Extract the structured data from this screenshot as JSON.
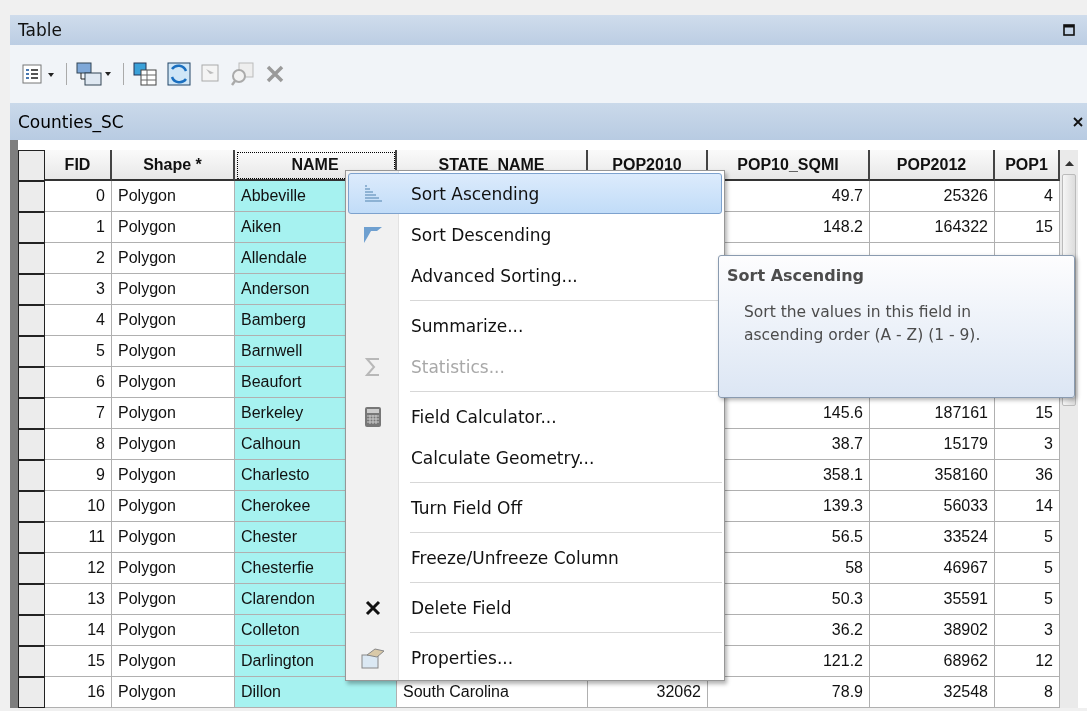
{
  "window": {
    "title": "Table"
  },
  "table_tab": {
    "title": "Counties_SC"
  },
  "columns": [
    {
      "label": "FID",
      "selected": false
    },
    {
      "label": "Shape *",
      "selected": false
    },
    {
      "label": "NAME",
      "selected": true
    },
    {
      "label": "STATE_NAME",
      "selected": false
    },
    {
      "label": "POP2010",
      "selected": false
    },
    {
      "label": "POP10_SQMI",
      "selected": false
    },
    {
      "label": "POP2012",
      "selected": false
    },
    {
      "label": "POP1",
      "selected": false
    }
  ],
  "rows": [
    {
      "fid": "0",
      "shape": "Polygon",
      "name": "Abbeville",
      "pop10_sqmi": "49.7",
      "pop2012": "25326",
      "pop1": "4"
    },
    {
      "fid": "1",
      "shape": "Polygon",
      "name": "Aiken",
      "pop10_sqmi": "148.2",
      "pop2012": "164322",
      "pop1": "15"
    },
    {
      "fid": "2",
      "shape": "Polygon",
      "name": "Allendale"
    },
    {
      "fid": "3",
      "shape": "Polygon",
      "name": "Anderson"
    },
    {
      "fid": "4",
      "shape": "Polygon",
      "name": "Bamberg"
    },
    {
      "fid": "5",
      "shape": "Polygon",
      "name": "Barnwell"
    },
    {
      "fid": "6",
      "shape": "Polygon",
      "name": "Beaufort"
    },
    {
      "fid": "7",
      "shape": "Polygon",
      "name": "Berkeley",
      "pop10_sqmi": "145.6",
      "pop2012": "187161",
      "pop1": "15"
    },
    {
      "fid": "8",
      "shape": "Polygon",
      "name": "Calhoun",
      "pop10_sqmi": "38.7",
      "pop2012": "15179",
      "pop1": "3"
    },
    {
      "fid": "9",
      "shape": "Polygon",
      "name": "Charlesto",
      "pop10_sqmi": "358.1",
      "pop2012": "358160",
      "pop1": "36"
    },
    {
      "fid": "10",
      "shape": "Polygon",
      "name": "Cherokee",
      "pop10_sqmi": "139.3",
      "pop2012": "56033",
      "pop1": "14"
    },
    {
      "fid": "11",
      "shape": "Polygon",
      "name": "Chester",
      "pop10_sqmi": "56.5",
      "pop2012": "33524",
      "pop1": "5"
    },
    {
      "fid": "12",
      "shape": "Polygon",
      "name": "Chesterfie",
      "pop10_sqmi": "58",
      "pop2012": "46967",
      "pop1": "5"
    },
    {
      "fid": "13",
      "shape": "Polygon",
      "name": "Clarendon",
      "pop10_sqmi": "50.3",
      "pop2012": "35591",
      "pop1": "5"
    },
    {
      "fid": "14",
      "shape": "Polygon",
      "name": "Colleton",
      "pop10_sqmi": "36.2",
      "pop2012": "38902",
      "pop1": "3"
    },
    {
      "fid": "15",
      "shape": "Polygon",
      "name": "Darlington",
      "pop10_sqmi": "121.2",
      "pop2012": "68962",
      "pop1": "12"
    },
    {
      "fid": "16",
      "shape": "Polygon",
      "name": "Dillon",
      "state_name": "South Carolina",
      "pop2010": "32062",
      "pop10_sqmi": "78.9",
      "pop2012": "32548",
      "pop1": "8"
    }
  ],
  "context_menu": {
    "groups": [
      [
        {
          "label": "Sort Ascending",
          "selected": true,
          "disabled": false
        },
        {
          "label": "Sort Descending",
          "selected": false,
          "disabled": false
        },
        {
          "label": "Advanced Sorting...",
          "selected": false,
          "disabled": false
        }
      ],
      [
        {
          "label": "Summarize...",
          "selected": false,
          "disabled": false
        },
        {
          "label": "Statistics...",
          "selected": false,
          "disabled": true
        }
      ],
      [
        {
          "label": "Field Calculator...",
          "selected": false,
          "disabled": false
        },
        {
          "label": "Calculate Geometry...",
          "selected": false,
          "disabled": false
        }
      ],
      [
        {
          "label": "Turn Field Off",
          "selected": false,
          "disabled": false
        }
      ],
      [
        {
          "label": "Freeze/Unfreeze Column",
          "selected": false,
          "disabled": false
        }
      ],
      [
        {
          "label": "Delete Field",
          "selected": false,
          "disabled": false
        }
      ],
      [
        {
          "label": "Properties...",
          "selected": false,
          "disabled": false
        }
      ]
    ]
  },
  "tooltip": {
    "title": "Sort Ascending",
    "text": "Sort the values in this field in ascending order (A - Z) (1 - 9)."
  }
}
